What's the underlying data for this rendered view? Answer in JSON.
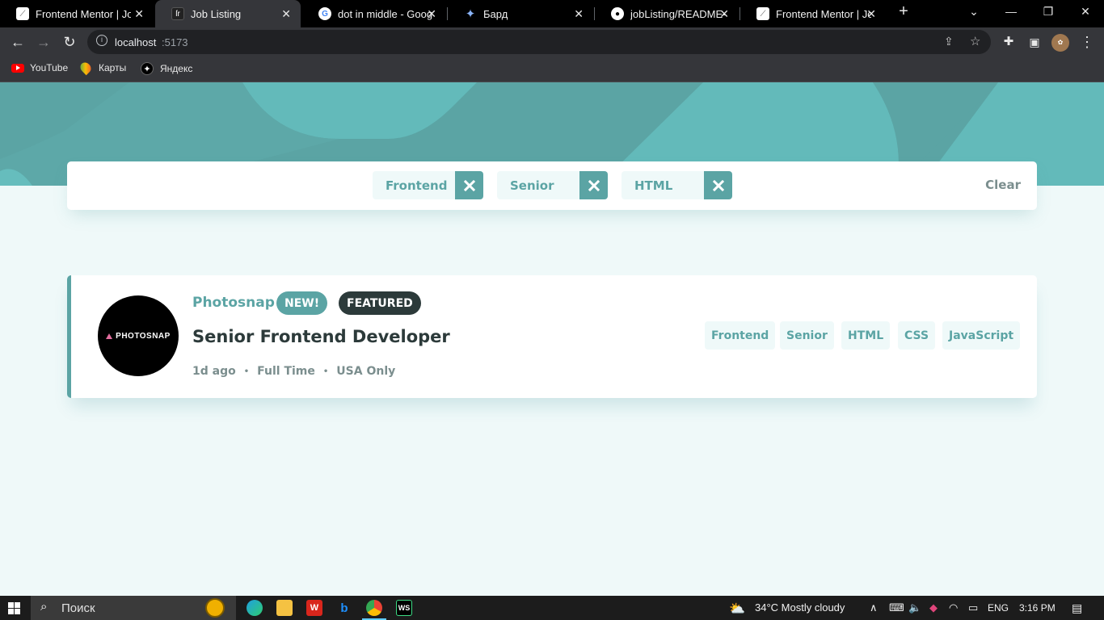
{
  "browser": {
    "tabs": [
      {
        "title": "Frontend Mentor | Job",
        "active": false,
        "icon": "fm-icon"
      },
      {
        "title": "Job Listing",
        "active": true,
        "icon": "vite-icon"
      },
      {
        "title": "dot in middle - Google",
        "active": false,
        "icon": "google-icon"
      },
      {
        "title": "Бард",
        "active": false,
        "icon": "bard-icon"
      },
      {
        "title": "jobListing/README-te",
        "active": false,
        "icon": "github-icon"
      },
      {
        "title": "Frontend Mentor | Job",
        "active": false,
        "icon": "fm-icon"
      }
    ],
    "url_host": "localhost",
    "url_port": ":5173",
    "bookmarks": [
      {
        "label": "YouTube",
        "icon": "youtube-icon"
      },
      {
        "label": "Карты",
        "icon": "maps-icon"
      },
      {
        "label": "Яндекс",
        "icon": "yandex-icon"
      }
    ]
  },
  "filters": {
    "chips": [
      "Frontend",
      "Senior",
      "HTML"
    ],
    "clear_label": "Clear"
  },
  "job": {
    "company": "Photosnap",
    "new_label": "NEW!",
    "featured_label": "FEATURED",
    "logo_text": "PHOTOSNAP",
    "position": "Senior Frontend Developer",
    "posted": "1d ago",
    "contract": "Full Time",
    "location": "USA Only",
    "tags": [
      "Frontend",
      "Senior",
      "HTML",
      "CSS",
      "JavaScript"
    ]
  },
  "taskbar": {
    "search_placeholder": "Поиск",
    "weather": "34°C  Mostly cloudy",
    "lang": "ENG",
    "time": "3:16 PM"
  },
  "colors": {
    "primary": "#5ba4a4",
    "dark": "#2c3a3a",
    "bg": "#eff9f9"
  }
}
